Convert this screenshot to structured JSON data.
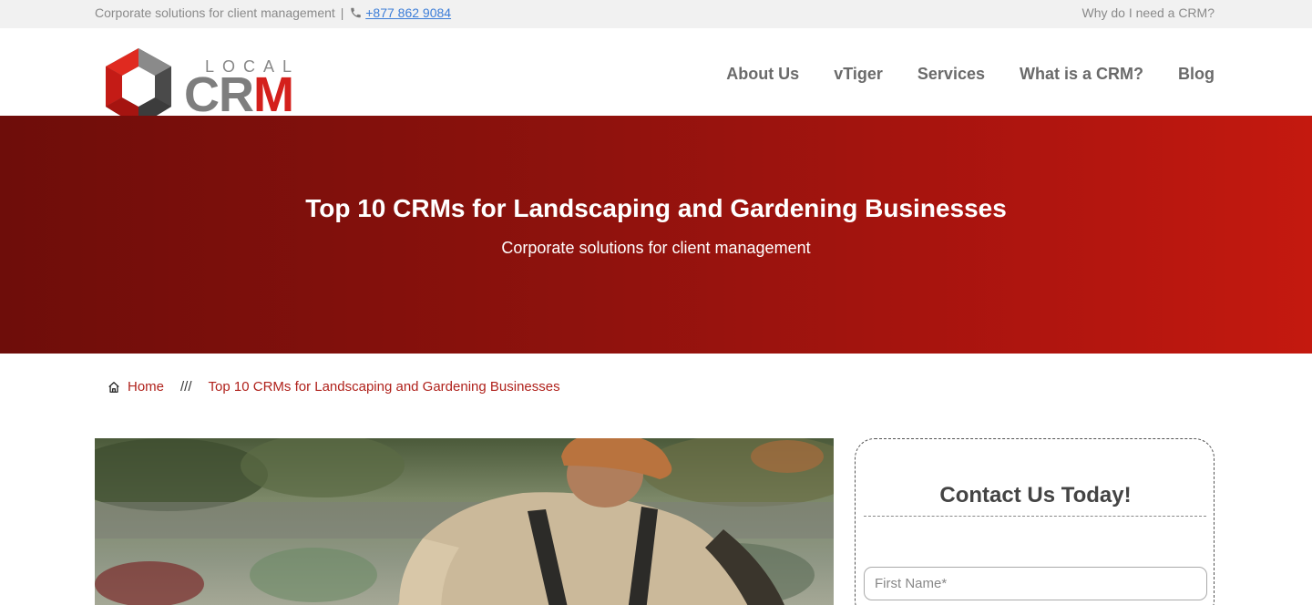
{
  "topbar": {
    "tagline": "Corporate solutions for client management",
    "separator": "|",
    "phone": "+877 862 9084",
    "right_link": "Why do I need a CRM?"
  },
  "logo": {
    "local": "LOCAL",
    "crm_cr": "CR",
    "crm_m": "M"
  },
  "nav": {
    "items": [
      {
        "label": "About Us"
      },
      {
        "label": "vTiger"
      },
      {
        "label": "Services"
      },
      {
        "label": "What is a CRM?"
      },
      {
        "label": "Blog"
      }
    ]
  },
  "hero": {
    "title": "Top 10 CRMs for Landscaping and Gardening Businesses",
    "subtitle": "Corporate solutions for client management"
  },
  "breadcrumb": {
    "home": "Home",
    "separator": "///",
    "current": "Top 10 CRMs for Landscaping and Gardening Businesses"
  },
  "contact": {
    "title": "Contact Us Today!",
    "first_name_placeholder": "First Name*"
  },
  "colors": {
    "accent": "#d4201c",
    "link": "#3b7dd8",
    "hero_dark": "#6e0d0a",
    "hero_light": "#c4190f"
  }
}
